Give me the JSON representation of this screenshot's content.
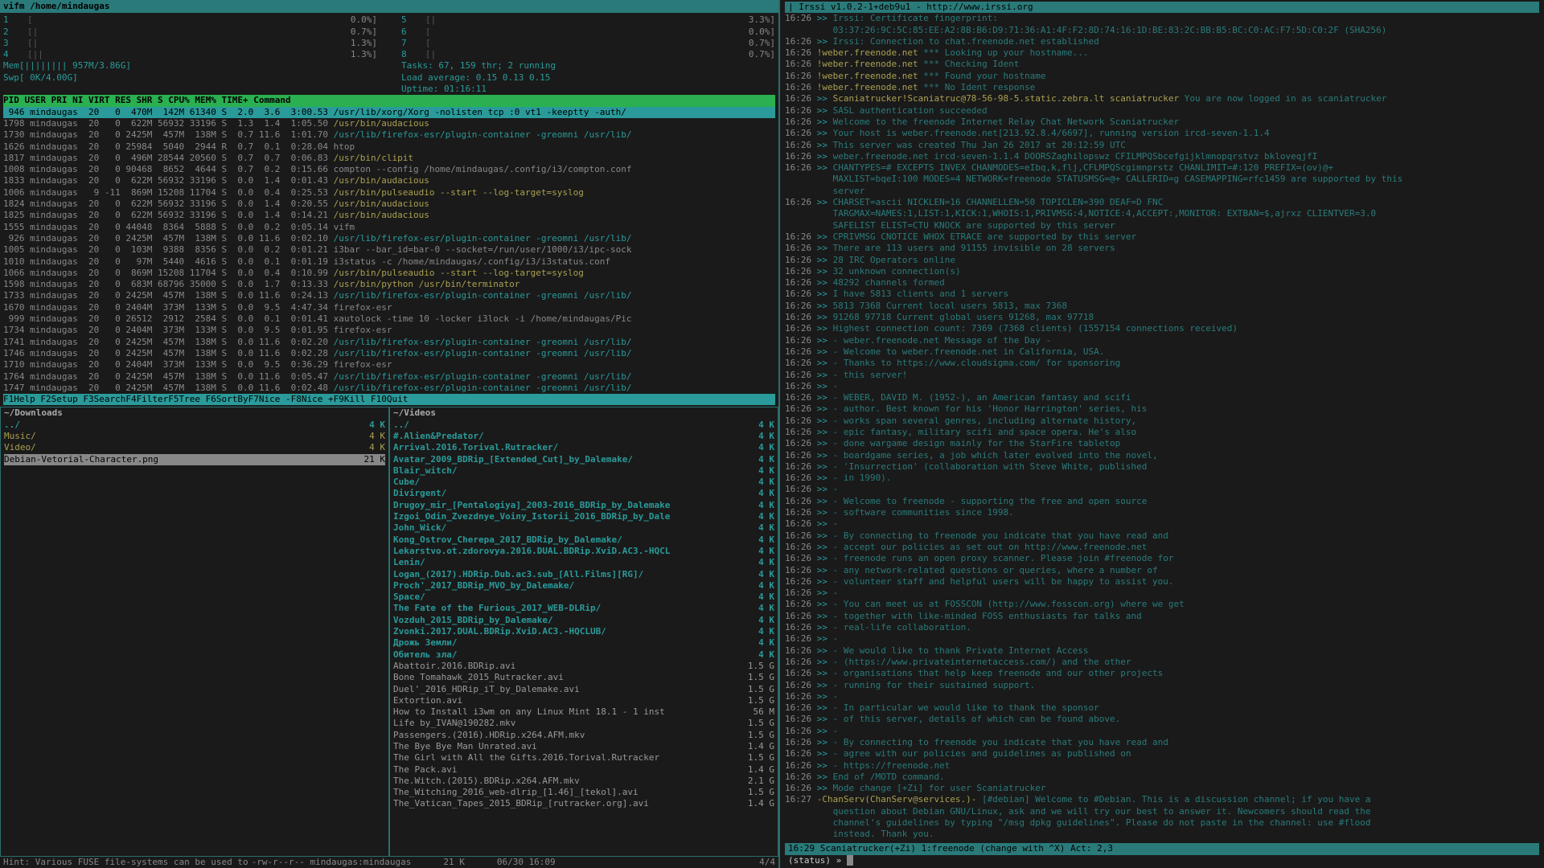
{
  "vifm_title": "vifm   /home/mindaugas",
  "htop": {
    "cpu_meters_left": [
      {
        "n": "1",
        "bar": "[",
        "pct": "0.0%]"
      },
      {
        "n": "2",
        "bar": "[|",
        "pct": "0.7%]"
      },
      {
        "n": "3",
        "bar": "[|",
        "pct": "1.3%]"
      },
      {
        "n": "4",
        "bar": "[||",
        "pct": "1.3%]"
      }
    ],
    "cpu_meters_right": [
      {
        "n": "5",
        "bar": "[|",
        "pct": "3.3%]"
      },
      {
        "n": "6",
        "bar": "[",
        "pct": "0.0%]"
      },
      {
        "n": "7",
        "bar": "[",
        "pct": "0.7%]"
      },
      {
        "n": "8",
        "bar": "[|",
        "pct": "0.7%]"
      }
    ],
    "mem": "Mem[||||||||                              957M/3.86G]",
    "swp": "Swp[                                        0K/4.00G]",
    "tasks": "Tasks: 67, 159 thr; 2 running",
    "load": "Load average: 0.15 0.13 0.15",
    "uptime": "Uptime: 01:16:11",
    "header": "  PID USER      PRI  NI  VIRT   RES   SHR S CPU% MEM%   TIME+  Command",
    "rows": [
      {
        "pid": " 946 mindaugas  20   0  470M  142M 61340 S  2.0  3.6  3:00.53",
        "cmd": "/usr/lib/xorg/Xorg -nolisten tcp :0 vt1 -keeptty -auth/",
        "sel": true
      },
      {
        "pid": "1798 mindaugas  20   0  622M 56932 33196 S  1.3  1.4  1:05.50",
        "cmd": "/usr/bin/audacious",
        "cls": "proc-cmd-y"
      },
      {
        "pid": "1730 mindaugas  20   0 2425M  457M  138M S  0.7 11.6  1:01.70",
        "cmd": "/usr/lib/firefox-esr/plugin-container -greomni /usr/lib/",
        "cls": "proc-grn"
      },
      {
        "pid": "1626 mindaugas  20   0 25984  5040  2944 R  0.7  0.1  0:28.04",
        "cmd": "htop",
        "cls": "proc-norm"
      },
      {
        "pid": "1817 mindaugas  20   0  496M 28544 20560 S  0.7  0.7  0:06.83",
        "cmd": "/usr/bin/clipit",
        "cls": "proc-cmd-y"
      },
      {
        "pid": "1008 mindaugas  20   0 90468  8652  4644 S  0.7  0.2  0:15.66",
        "cmd": "compton --config /home/mindaugas/.config/i3/compton.conf",
        "cls": "proc-norm"
      },
      {
        "pid": "1833 mindaugas  20   0  622M 56932 33196 S  0.0  1.4  0:01.43",
        "cmd": "/usr/bin/audacious",
        "cls": "proc-cmd-y"
      },
      {
        "pid": "1006 mindaugas   9 -11  869M 15208 11704 S  0.0  0.4  0:25.53",
        "cmd": "/usr/bin/pulseaudio --start --log-target=syslog",
        "cls": "proc-cmd-y"
      },
      {
        "pid": "1824 mindaugas  20   0  622M 56932 33196 S  0.0  1.4  0:20.55",
        "cmd": "/usr/bin/audacious",
        "cls": "proc-cmd-y"
      },
      {
        "pid": "1825 mindaugas  20   0  622M 56932 33196 S  0.0  1.4  0:14.21",
        "cmd": "/usr/bin/audacious",
        "cls": "proc-cmd-y"
      },
      {
        "pid": "1555 mindaugas  20   0 44048  8364  5888 S  0.0  0.2  0:05.14",
        "cmd": "vifm",
        "cls": "proc-norm"
      },
      {
        "pid": " 926 mindaugas  20   0 2425M  457M  138M S  0.0 11.6  0:02.10",
        "cmd": "/usr/lib/firefox-esr/plugin-container -greomni /usr/lib/",
        "cls": "proc-grn"
      },
      {
        "pid": "1005 mindaugas  20   0  103M  9388  8356 S  0.0  0.2  0:01.21",
        "cmd": "i3bar --bar_id=bar-0 --socket=/run/user/1000/i3/ipc-sock",
        "cls": "proc-norm"
      },
      {
        "pid": "1010 mindaugas  20   0   97M  5440  4616 S  0.0  0.1  0:01.19",
        "cmd": "i3status -c /home/mindaugas/.config/i3/i3status.conf",
        "cls": "proc-norm"
      },
      {
        "pid": "1066 mindaugas  20   0  869M 15208 11704 S  0.0  0.4  0:10.99",
        "cmd": "/usr/bin/pulseaudio --start --log-target=syslog",
        "cls": "proc-cmd-y"
      },
      {
        "pid": "1598 mindaugas  20   0  683M 68796 35000 S  0.0  1.7  0:13.33",
        "cmd": "/usr/bin/python /usr/bin/terminator",
        "cls": "proc-cmd-y"
      },
      {
        "pid": "1733 mindaugas  20   0 2425M  457M  138M S  0.0 11.6  0:24.13",
        "cmd": "/usr/lib/firefox-esr/plugin-container -greomni /usr/lib/",
        "cls": "proc-grn"
      },
      {
        "pid": "1670 mindaugas  20   0 2404M  373M  133M S  0.0  9.5  4:47.34",
        "cmd": "firefox-esr",
        "cls": "proc-norm"
      },
      {
        "pid": " 999 mindaugas  20   0 26512  2912  2584 S  0.0  0.1  0:01.41",
        "cmd": "xautolock -time 10 -locker i3lock -i /home/mindaugas/Pic",
        "cls": "proc-norm"
      },
      {
        "pid": "1734 mindaugas  20   0 2404M  373M  133M S  0.0  9.5  0:01.95",
        "cmd": "firefox-esr",
        "cls": "proc-norm"
      },
      {
        "pid": "1741 mindaugas  20   0 2425M  457M  138M S  0.0 11.6  0:02.20",
        "cmd": "/usr/lib/firefox-esr/plugin-container -greomni /usr/lib/",
        "cls": "proc-grn"
      },
      {
        "pid": "1746 mindaugas  20   0 2425M  457M  138M S  0.0 11.6  0:02.28",
        "cmd": "/usr/lib/firefox-esr/plugin-container -greomni /usr/lib/",
        "cls": "proc-grn"
      },
      {
        "pid": "1710 mindaugas  20   0 2404M  373M  133M S  0.0  9.5  0:36.29",
        "cmd": "firefox-esr",
        "cls": "proc-norm"
      },
      {
        "pid": "1764 mindaugas  20   0 2425M  457M  138M S  0.0 11.6  0:05.47",
        "cmd": "/usr/lib/firefox-esr/plugin-container -greomni /usr/lib/",
        "cls": "proc-grn"
      },
      {
        "pid": "1747 mindaugas  20   0 2425M  457M  138M S  0.0 11.6  0:02.48",
        "cmd": "/usr/lib/firefox-esr/plugin-container -greomni /usr/lib/",
        "cls": "proc-grn"
      }
    ],
    "fkeys": "F1Help  F2Setup F3SearchF4FilterF5Tree  F6SortByF7Nice -F8Nice +F9Kill  F10Quit"
  },
  "vifm_left": {
    "title": "~/Downloads",
    "files": [
      {
        "name": "../",
        "size": "4 K",
        "cls": "f-dir"
      },
      {
        "name": "Music/",
        "size": "4 K",
        "cls": "f-yellow"
      },
      {
        "name": "Video/",
        "size": "4 K",
        "cls": "f-yellow"
      },
      {
        "name": "Debian-Vetorial-Character.png",
        "size": "21 K",
        "cls": "f-sel"
      }
    ]
  },
  "vifm_right": {
    "title": "~/Videos",
    "files": [
      {
        "name": "../",
        "size": "4 K",
        "cls": "f-dir"
      },
      {
        "name": "#.Alien&Predator/",
        "size": "4 K",
        "cls": "f-dir"
      },
      {
        "name": "Arrival.2016.Torival.Rutracker/",
        "size": "4 K",
        "cls": "f-dir"
      },
      {
        "name": "Avatar_2009_BDRip_[Extended_Cut]_by_Dalemake/",
        "size": "4 K",
        "cls": "f-dir"
      },
      {
        "name": "Blair_witch/",
        "size": "4 K",
        "cls": "f-dir"
      },
      {
        "name": "Cube/",
        "size": "4 K",
        "cls": "f-dir"
      },
      {
        "name": "Divirgent/",
        "size": "4 K",
        "cls": "f-dir"
      },
      {
        "name": "Drugoy_mir_[Pentalogiya]_2003-2016_BDRip_by_Dalemake",
        "size": "4 K",
        "cls": "f-dir"
      },
      {
        "name": "Izgoi_Odin_Zvezdnye_Voiny_Istorii_2016_BDRip_by_Dale",
        "size": "4 K",
        "cls": "f-dir"
      },
      {
        "name": "John_Wick/",
        "size": "4 K",
        "cls": "f-dir"
      },
      {
        "name": "Kong_Ostrov_Cherepa_2017_BDRip_by_Dalemake/",
        "size": "4 K",
        "cls": "f-dir"
      },
      {
        "name": "Lekarstvo.ot.zdorovya.2016.DUAL.BDRip.XviD.AC3.-HQCL",
        "size": "4 K",
        "cls": "f-dir"
      },
      {
        "name": "Lenin/",
        "size": "4 K",
        "cls": "f-dir"
      },
      {
        "name": "Logan_(2017).HDRip.Dub.ac3.sub_[All.Films][RG]/",
        "size": "4 K",
        "cls": "f-dir"
      },
      {
        "name": "Proch'_2017_BDRip_MVO_by_Dalemake/",
        "size": "4 K",
        "cls": "f-dir"
      },
      {
        "name": "Space/",
        "size": "4 K",
        "cls": "f-dir"
      },
      {
        "name": "The Fate of the Furious_2017_WEB-DLRip/",
        "size": "4 K",
        "cls": "f-dir"
      },
      {
        "name": "Vozduh_2015_BDRip_by_Dalemake/",
        "size": "4 K",
        "cls": "f-dir"
      },
      {
        "name": "Zvonki.2017.DUAL.BDRip.XviD.AC3.-HQCLUB/",
        "size": "4 K",
        "cls": "f-dir"
      },
      {
        "name": "Дрожь Земли/",
        "size": "4 K",
        "cls": "f-dir"
      },
      {
        "name": "Обитель зла/",
        "size": "4 K",
        "cls": "f-dir"
      },
      {
        "name": "Abattoir.2016.BDRip.avi",
        "size": "1.5 G",
        "cls": "f-file"
      },
      {
        "name": "Bone Tomahawk_2015_Rutracker.avi",
        "size": "1.5 G",
        "cls": "f-file"
      },
      {
        "name": "Duel'_2016_HDRip_iT_by_Dalemake.avi",
        "size": "1.5 G",
        "cls": "f-file"
      },
      {
        "name": "Extortion.avi",
        "size": "1.5 G",
        "cls": "f-file"
      },
      {
        "name": "How to Install i3wm on any Linux Mint 18.1 - 1 inst",
        "size": "56 M",
        "cls": "f-file"
      },
      {
        "name": "Life by_IVAN@190282.mkv",
        "size": "1.5 G",
        "cls": "f-file"
      },
      {
        "name": "Passengers.(2016).HDRip.x264.AFM.mkv",
        "size": "1.5 G",
        "cls": "f-file"
      },
      {
        "name": "The Bye Bye Man Unrated.avi",
        "size": "1.4 G",
        "cls": "f-file"
      },
      {
        "name": "The Girl with All the Gifts.2016.Torival.Rutracker",
        "size": "1.5 G",
        "cls": "f-file"
      },
      {
        "name": "The Pack.avi",
        "size": "1.4 G",
        "cls": "f-file"
      },
      {
        "name": "The.Witch.(2015).BDRip.x264.AFM.mkv",
        "size": "2.1 G",
        "cls": "f-file"
      },
      {
        "name": "The_Witching_2016_web-dlrip_[1.46]_[tekol].avi",
        "size": "1.5 G",
        "cls": "f-file"
      },
      {
        "name": "The_Vatican_Tapes_2015_BDRip_[rutracker.org].avi",
        "size": "1.4 G",
        "cls": "f-file"
      }
    ]
  },
  "vifm_hint": "Hint: Various FUSE file-systems can be used to",
  "vifm_status_left": "-rw-r--r--   mindaugas:mindaugas",
  "vifm_status_mid": "21 K",
  "vifm_status_date": "06/30 16:09",
  "vifm_status_right": "4/4",
  "irssi": {
    "header": "| Irssi v1.0.2-1+deb9u1 - http://www.irssi.org",
    "lines": [
      {
        "t": "16:26",
        "s": ">>",
        "m": "Irssi: Certificate fingerprint:"
      },
      {
        "t": "",
        "s": "",
        "m": "         03:37:26:9C:5C:85:EE:A2:8B:B6:D9:71:36:A1:4F:F2:8D:74:16:1D:BE:83:2C:BB:B5:BC:C0:AC:F7:5D:C0:2F (SHA256)"
      },
      {
        "t": "16:26",
        "s": ">>",
        "m": "Irssi: Connection to chat.freenode.net established",
        "srv": ""
      },
      {
        "t": "16:26",
        "s": "",
        "srv": "!weber.freenode.net",
        "m": " *** Looking up your hostname..."
      },
      {
        "t": "16:26",
        "s": "",
        "srv": "!weber.freenode.net",
        "m": " *** Checking Ident"
      },
      {
        "t": "16:26",
        "s": "",
        "srv": "!weber.freenode.net",
        "m": " *** Found your hostname"
      },
      {
        "t": "16:26",
        "s": "",
        "srv": "!weber.freenode.net",
        "m": " *** No Ident response"
      },
      {
        "t": "16:26",
        "s": ">>",
        "srv": "Scaniatrucker!Scaniatruc@78-56-98-5.static.zebra.lt scaniatrucker",
        "m": " You are now logged in as scaniatrucker"
      },
      {
        "t": "16:26",
        "s": ">>",
        "m": "SASL authentication succeeded"
      },
      {
        "t": "16:26",
        "s": ">>",
        "m": "Welcome to the freenode Internet Relay Chat Network Scaniatrucker"
      },
      {
        "t": "16:26",
        "s": ">>",
        "m": "Your host is weber.freenode.net[213.92.8.4/6697], running version ircd-seven-1.1.4"
      },
      {
        "t": "16:26",
        "s": ">>",
        "m": "This server was created Thu Jan 26 2017 at 20:12:59 UTC"
      },
      {
        "t": "16:26",
        "s": ">>",
        "m": "weber.freenode.net ircd-seven-1.1.4 DOORSZaghilopswz CFILMPQSbcefgijklmnopqrstvz bkloveqjfI"
      },
      {
        "t": "16:26",
        "s": ">>",
        "m": "CHANTYPES=# EXCEPTS INVEX CHANMODES=eIbq,k,flj,CFLMPQScgimnprstz CHANLIMIT=#:120 PREFIX=(ov)@+"
      },
      {
        "t": "",
        "s": "",
        "m": "         MAXLIST=bqeI:100 MODES=4 NETWORK=freenode STATUSMSG=@+ CALLERID=g CASEMAPPING=rfc1459 are supported by this"
      },
      {
        "t": "",
        "s": "",
        "m": "         server"
      },
      {
        "t": "16:26",
        "s": ">>",
        "m": "CHARSET=ascii NICKLEN=16 CHANNELLEN=50 TOPICLEN=390 DEAF=D FNC"
      },
      {
        "t": "",
        "s": "",
        "m": "         TARGMAX=NAMES:1,LIST:1,KICK:1,WHOIS:1,PRIVMSG:4,NOTICE:4,ACCEPT:,MONITOR: EXTBAN=$,ajrxz CLIENTVER=3.0"
      },
      {
        "t": "",
        "s": "",
        "m": "         SAFELIST ELIST=CTU KNOCK are supported by this server"
      },
      {
        "t": "16:26",
        "s": ">>",
        "m": "CPRIVMSG CNOTICE WHOX ETRACE are supported by this server"
      },
      {
        "t": "16:26",
        "s": ">>",
        "m": "There are 113 users and 91155 invisible on 28 servers"
      },
      {
        "t": "16:26",
        "s": ">>",
        "m": "28 IRC Operators online"
      },
      {
        "t": "16:26",
        "s": ">>",
        "m": "32 unknown connection(s)"
      },
      {
        "t": "16:26",
        "s": ">>",
        "m": "48292 channels formed"
      },
      {
        "t": "16:26",
        "s": ">>",
        "m": "I have 5813 clients and 1 servers"
      },
      {
        "t": "16:26",
        "s": ">>",
        "m": "5813 7368 Current local users 5813, max 7368"
      },
      {
        "t": "16:26",
        "s": ">>",
        "m": "91268 97718 Current global users 91268, max 97718"
      },
      {
        "t": "16:26",
        "s": ">>",
        "m": "Highest connection count: 7369 (7368 clients) (1557154 connections received)"
      },
      {
        "t": "16:26",
        "s": ">>",
        "m": "- weber.freenode.net Message of the Day -"
      },
      {
        "t": "16:26",
        "s": ">>",
        "m": "- Welcome to weber.freenode.net in California, USA."
      },
      {
        "t": "16:26",
        "s": ">>",
        "m": "- Thanks to https://www.cloudsigma.com/ for sponsoring"
      },
      {
        "t": "16:26",
        "s": ">>",
        "m": "- this server!"
      },
      {
        "t": "16:26",
        "s": ">>",
        "m": "-"
      },
      {
        "t": "16:26",
        "s": ">>",
        "m": "- WEBER, DAVID M. (1952-), an American fantasy and scifi"
      },
      {
        "t": "16:26",
        "s": ">>",
        "m": "- author. Best known for his 'Honor Harrington' series, his"
      },
      {
        "t": "16:26",
        "s": ">>",
        "m": "- works span several genres, including alternate history,"
      },
      {
        "t": "16:26",
        "s": ">>",
        "m": "- epic fantasy, military scifi and space opera. He's also"
      },
      {
        "t": "16:26",
        "s": ">>",
        "m": "- done wargame design mainly for the StarFire tabletop"
      },
      {
        "t": "16:26",
        "s": ">>",
        "m": "- boardgame series, a job which later evolved into the novel,"
      },
      {
        "t": "16:26",
        "s": ">>",
        "m": "- 'Insurrection' (collaboration with Steve White, published"
      },
      {
        "t": "16:26",
        "s": ">>",
        "m": "- in 1990)."
      },
      {
        "t": "16:26",
        "s": ">>",
        "m": "-"
      },
      {
        "t": "16:26",
        "s": ">>",
        "m": "- Welcome to freenode - supporting the free and open source"
      },
      {
        "t": "16:26",
        "s": ">>",
        "m": "- software communities since 1998."
      },
      {
        "t": "16:26",
        "s": ">>",
        "m": "-"
      },
      {
        "t": "16:26",
        "s": ">>",
        "m": "- By connecting to freenode you indicate that you have read and"
      },
      {
        "t": "16:26",
        "s": ">>",
        "m": "- accept our policies as set out on http://www.freenode.net"
      },
      {
        "t": "16:26",
        "s": ">>",
        "m": "- freenode runs an open proxy scanner. Please join #freenode for"
      },
      {
        "t": "16:26",
        "s": ">>",
        "m": "- any network-related questions or queries, where a number of"
      },
      {
        "t": "16:26",
        "s": ">>",
        "m": "- volunteer staff and helpful users will be happy to assist you."
      },
      {
        "t": "16:26",
        "s": ">>",
        "m": "-"
      },
      {
        "t": "16:26",
        "s": ">>",
        "m": "- You can meet us at FOSSCON (http://www.fosscon.org) where we get"
      },
      {
        "t": "16:26",
        "s": ">>",
        "m": "- together with like-minded FOSS enthusiasts for talks and"
      },
      {
        "t": "16:26",
        "s": ">>",
        "m": "- real-life collaboration."
      },
      {
        "t": "16:26",
        "s": ">>",
        "m": "-"
      },
      {
        "t": "16:26",
        "s": ">>",
        "m": "- We would like to thank Private Internet Access"
      },
      {
        "t": "16:26",
        "s": ">>",
        "m": "- (https://www.privateinternetaccess.com/) and the other"
      },
      {
        "t": "16:26",
        "s": ">>",
        "m": "- organisations that help keep freenode and our other projects"
      },
      {
        "t": "16:26",
        "s": ">>",
        "m": "- running for their sustained support."
      },
      {
        "t": "16:26",
        "s": ">>",
        "m": "-"
      },
      {
        "t": "16:26",
        "s": ">>",
        "m": "- In particular we would like to thank the sponsor"
      },
      {
        "t": "16:26",
        "s": ">>",
        "m": "- of this server, details of which can be found above."
      },
      {
        "t": "16:26",
        "s": ">>",
        "m": "-"
      },
      {
        "t": "16:26",
        "s": ">>",
        "m": "- By connecting to freenode you indicate that you have read and"
      },
      {
        "t": "16:26",
        "s": ">>",
        "m": "- agree with our policies and guidelines as published on"
      },
      {
        "t": "16:26",
        "s": ">>",
        "m": "- https://freenode.net"
      },
      {
        "t": "16:26",
        "s": ">>",
        "m": "End of /MOTD command."
      },
      {
        "t": "16:26",
        "s": ">>",
        "m": "Mode change [+Zi] for user Scaniatrucker"
      },
      {
        "t": "16:27",
        "s": "",
        "srv": "-ChanServ(ChanServ@services.)-",
        "m": " [#debian] Welcome to #Debian. This is a discussion channel; if you have a"
      },
      {
        "t": "",
        "s": "",
        "m": "         question about Debian GNU/Linux, ask and we will try our best to answer it. Newcomers should read the"
      },
      {
        "t": "",
        "s": "",
        "m": "         channel's guidelines by typing \"/msg dpkg guidelines\". Please do not paste in the channel: use #flood"
      },
      {
        "t": "",
        "s": "",
        "m": "         instead. Thank you."
      }
    ],
    "statusbar": "16:29   Scaniatrucker(+Zi)   1:freenode (change with ^X)  Act: 2,3",
    "prompt": "(status) » "
  }
}
